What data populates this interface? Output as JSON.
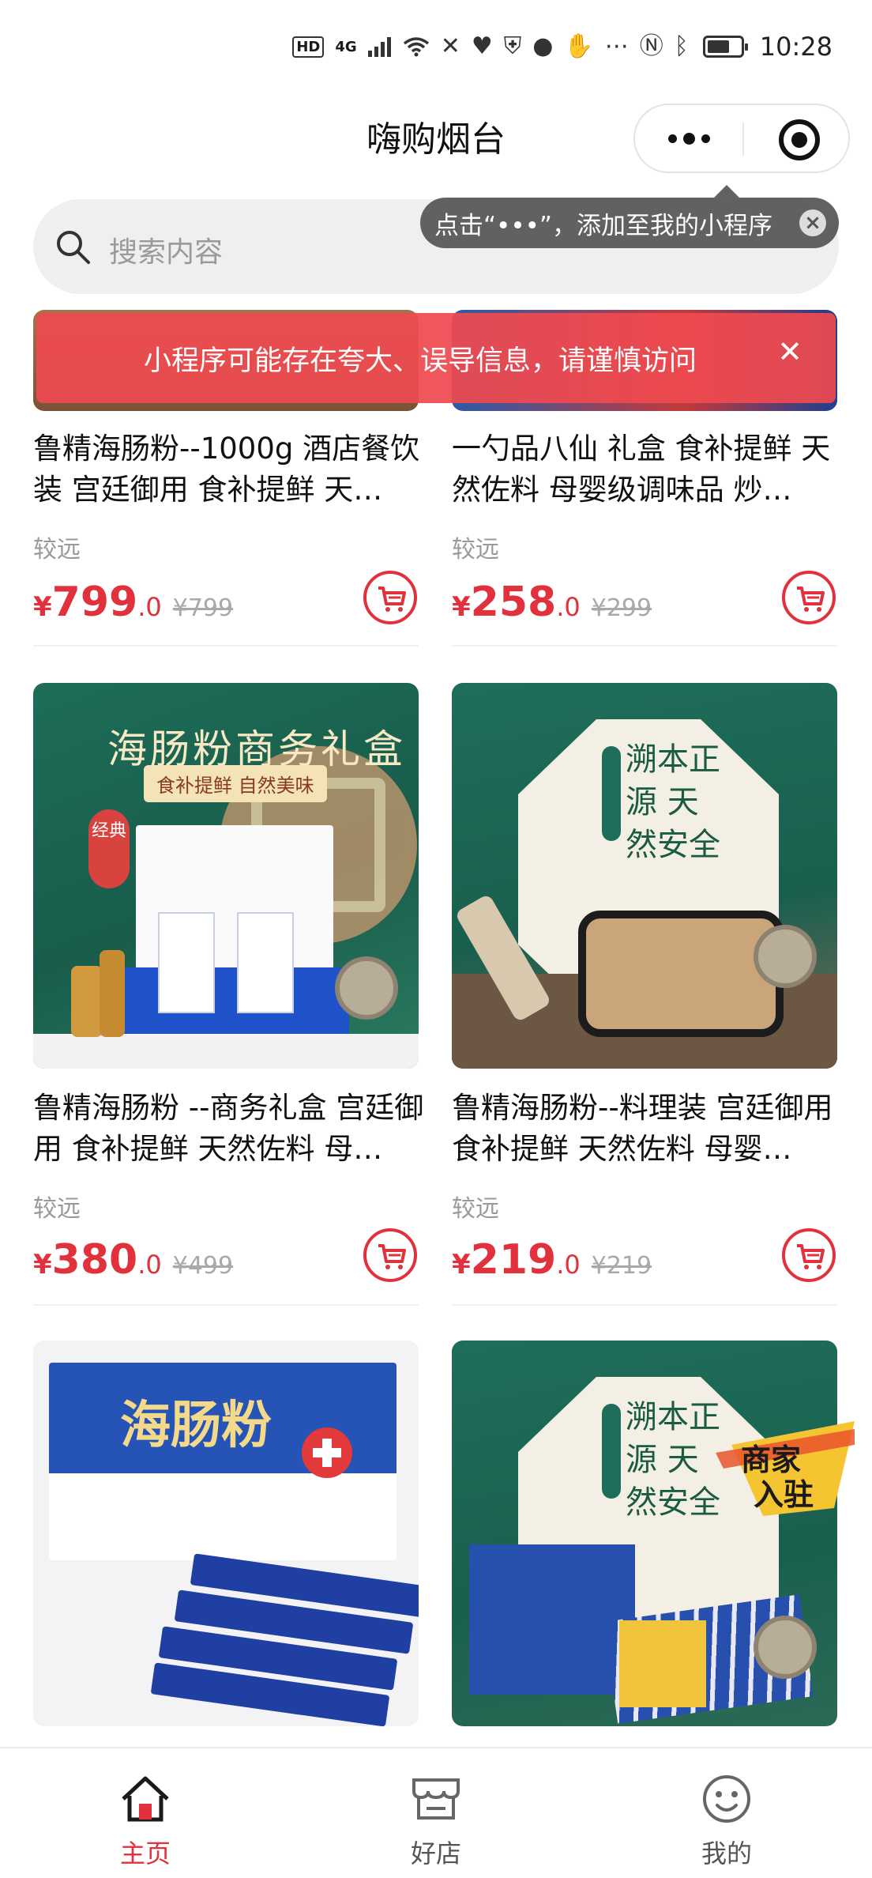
{
  "status_bar": {
    "time": "10:28",
    "hd": "HD",
    "network": "4G"
  },
  "nav": {
    "title": "嗨购烟台"
  },
  "search": {
    "placeholder": "搜索内容"
  },
  "tooltip": {
    "text": "点击“•••”，添加至我的小程序",
    "close": "×"
  },
  "warning": {
    "text": "小程序可能存在夸大、误导信息，请谨慎访问",
    "close": "✕"
  },
  "products": [
    {
      "title": "鲁精海肠粉--1000g 酒店餐饮装 宫廷御用 食补提鲜 天…",
      "distance": "较远",
      "price_symbol": "¥",
      "price_int": "799",
      "price_dec": ".0",
      "price_old": "¥799"
    },
    {
      "title": "一勺品八仙 礼盒 食补提鲜 天然佐料 母婴级调味品 炒…",
      "distance": "较远",
      "price_symbol": "¥",
      "price_int": "258",
      "price_dec": ".0",
      "price_old": "¥299"
    },
    {
      "title": "鲁精海肠粉 --商务礼盒 宫廷御用 食补提鲜 天然佐料 母…",
      "distance": "较远",
      "price_symbol": "¥",
      "price_int": "380",
      "price_dec": ".0",
      "price_old": "¥499",
      "image_text": {
        "title": "海肠粉商务礼盒",
        "subtitle": "食补提鲜 自然美味",
        "badge": "经典"
      }
    },
    {
      "title": "鲁精海肠粉--料理装 宫廷御用 食补提鲜 天然佐料 母婴…",
      "distance": "较远",
      "price_symbol": "¥",
      "price_int": "219",
      "price_dec": ".0",
      "price_old": "¥219",
      "image_text": {
        "slogan": "溯本正源 天然安全"
      }
    },
    {
      "title": "",
      "image_text": {
        "name": "海肠粉"
      }
    },
    {
      "title": "",
      "image_text": {
        "slogan": "溯本正源 天然安全"
      }
    }
  ],
  "merchant_badge": {
    "line1": "商家",
    "line2": "入驻"
  },
  "tab_bar": {
    "tabs": [
      {
        "label": "主页",
        "icon": "home-icon",
        "active": true
      },
      {
        "label": "好店",
        "icon": "shop-icon",
        "active": false
      },
      {
        "label": "我的",
        "icon": "smiley-icon",
        "active": false
      }
    ]
  },
  "colors": {
    "accent": "#e0313d",
    "warning_bg": "#ee4a50",
    "tooltip_bg": "#555555",
    "search_bg": "#efefef"
  }
}
